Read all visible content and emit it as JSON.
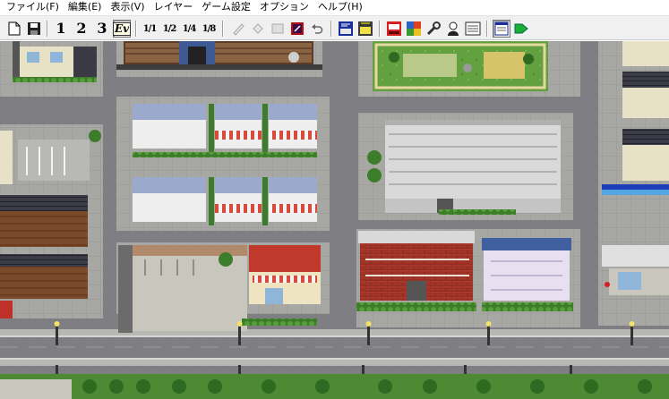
{
  "menubar": {
    "items": [
      {
        "label": "ファイル(F)"
      },
      {
        "label": "編集(E)"
      },
      {
        "label": "表示(V)"
      },
      {
        "label": "レイヤー"
      },
      {
        "label": "ゲーム設定"
      },
      {
        "label": "オプション"
      },
      {
        "label": "ヘルプ(H)"
      }
    ]
  },
  "toolbar": {
    "layer_labels": [
      "1",
      "2",
      "3"
    ],
    "event_label": "Ev",
    "scale_labels": [
      "1/1",
      "1/2",
      "1/4",
      "1/8"
    ],
    "active_tool": "event-layer",
    "active_scale": "1/1"
  },
  "colors": {
    "menu_bg": "#ffffff",
    "toolbar_bg": "#f0f0f0",
    "road": "#7e7e82",
    "sidewalk": "#a5a6a2",
    "grass": "#5e9a3c",
    "building_wall": "#efeedd",
    "roof_red": "#c8332b",
    "roof_blue": "#3f5f9f"
  }
}
